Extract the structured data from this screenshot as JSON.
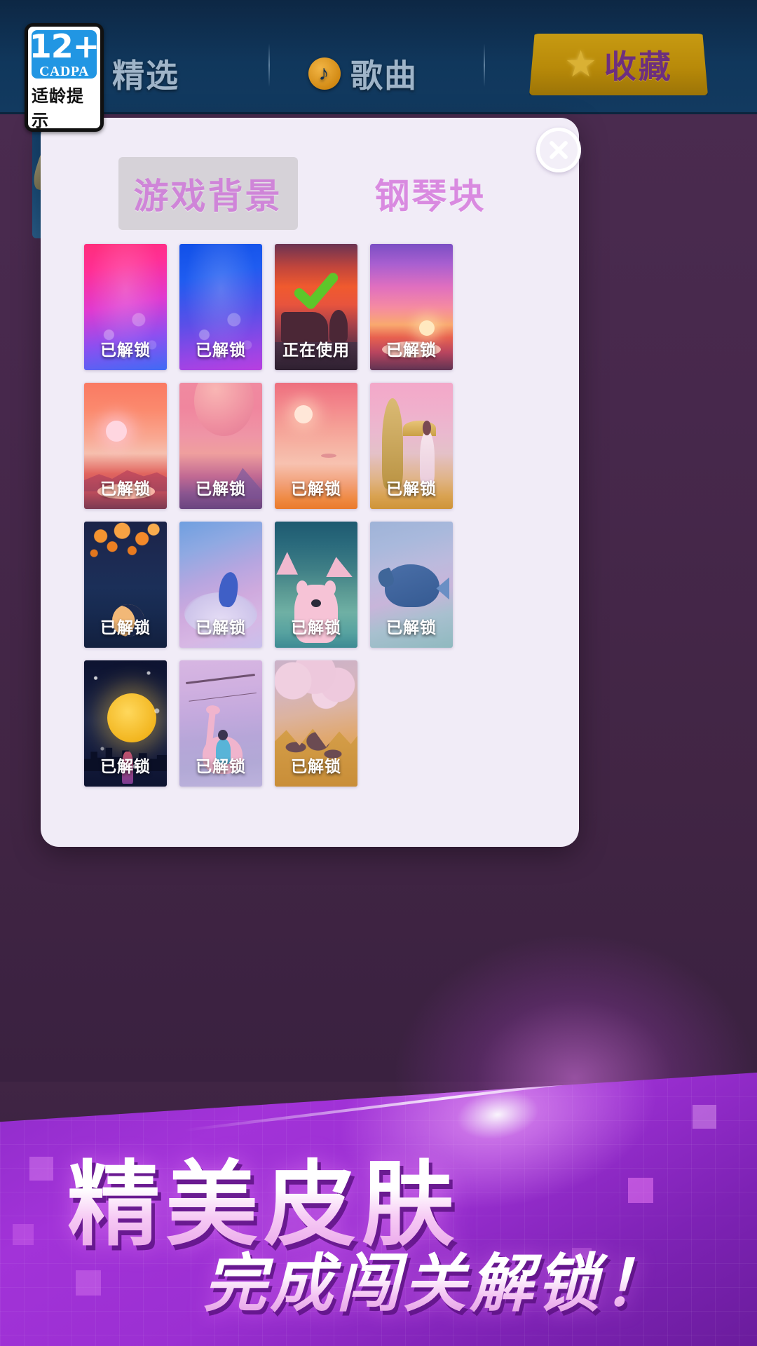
{
  "age_badge": {
    "age": "12+",
    "org": "CADPA",
    "note": "适龄提示"
  },
  "nav": {
    "items": [
      {
        "label": "精选",
        "icon": "none",
        "active": false
      },
      {
        "label": "歌曲",
        "icon": "music-note-icon",
        "active": false
      },
      {
        "label": "收藏",
        "icon": "star-icon",
        "active": true
      }
    ]
  },
  "modal": {
    "close_icon": "close-icon",
    "tabs": [
      {
        "label": "游戏背景",
        "active": true
      },
      {
        "label": "钢琴块",
        "active": false
      }
    ],
    "status_labels": {
      "unlocked": "已解锁",
      "in_use": "正在使用"
    },
    "items": [
      {
        "index": 1,
        "art": "neon-pink-blue-bokeh",
        "status": "已解锁",
        "selected": false
      },
      {
        "index": 2,
        "art": "neon-blue-purple-bokeh",
        "status": "已解锁",
        "selected": false
      },
      {
        "index": 3,
        "art": "sunset-piano-silhouette",
        "status": "正在使用",
        "selected": true
      },
      {
        "index": 4,
        "art": "violet-sunset-lake",
        "status": "已解锁",
        "selected": false
      },
      {
        "index": 5,
        "art": "coral-sunset-mountains",
        "status": "已解锁",
        "selected": false
      },
      {
        "index": 6,
        "art": "pink-planet-mountains",
        "status": "已解锁",
        "selected": false
      },
      {
        "index": 7,
        "art": "peach-sky-clouds",
        "status": "已解锁",
        "selected": false
      },
      {
        "index": 8,
        "art": "girl-umbrella-ginkgo",
        "status": "已解锁",
        "selected": false
      },
      {
        "index": 9,
        "art": "lantern-forest-moon",
        "status": "已解锁",
        "selected": false
      },
      {
        "index": 10,
        "art": "cloud-whale-dream",
        "status": "已解锁",
        "selected": false
      },
      {
        "index": 11,
        "art": "polar-bear-iceberg",
        "status": "已解锁",
        "selected": false
      },
      {
        "index": 12,
        "art": "flying-whale-sky",
        "status": "已解锁",
        "selected": false
      },
      {
        "index": 13,
        "art": "city-moonrise-girl",
        "status": "已解锁",
        "selected": false
      },
      {
        "index": 14,
        "art": "swan-boat-girl",
        "status": "已解锁",
        "selected": false
      },
      {
        "index": 15,
        "art": "pink-clouds-rocks",
        "status": "已解锁",
        "selected": false
      }
    ]
  },
  "promo": {
    "title": "精美皮肤",
    "subtitle": "完成闯关解锁！"
  },
  "colors": {
    "modal_bg": "#f1ecf7",
    "tab_active_bg": "#d6d2d8",
    "tab_text": "#d98ae0",
    "nav_bar": "#123052",
    "nav_fav": "#b88a09",
    "promo_bg": "#9b2fd2",
    "badge_blue": "#2196e3",
    "check_green": "#5dc62a"
  }
}
